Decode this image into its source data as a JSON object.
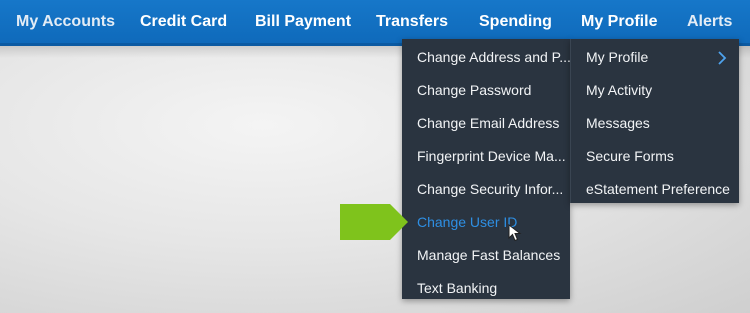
{
  "nav": {
    "items": [
      "My Accounts",
      "Credit Card",
      "Bill Payment",
      "Transfers",
      "Spending",
      "My Profile",
      "Alerts"
    ]
  },
  "menu": {
    "left": [
      "Change Address and P...",
      "Change Password",
      "Change Email Address",
      "Fingerprint Device Ma...",
      "Change Security Infor...",
      "Change User ID",
      "Manage Fast Balances",
      "Text Banking"
    ],
    "right": [
      "My Profile",
      "My Activity",
      "Messages",
      "Secure Forms",
      "eStatement Preference"
    ],
    "highlighted": "Change User ID"
  },
  "colors": {
    "nav_bg": "#1170c2",
    "menu_bg": "#2a3440",
    "highlight": "#2e8fe3",
    "arrow": "#7fc31c"
  },
  "icons": [
    "chevron-right-icon",
    "pointer-arrow-icon",
    "mouse-cursor-icon"
  ]
}
